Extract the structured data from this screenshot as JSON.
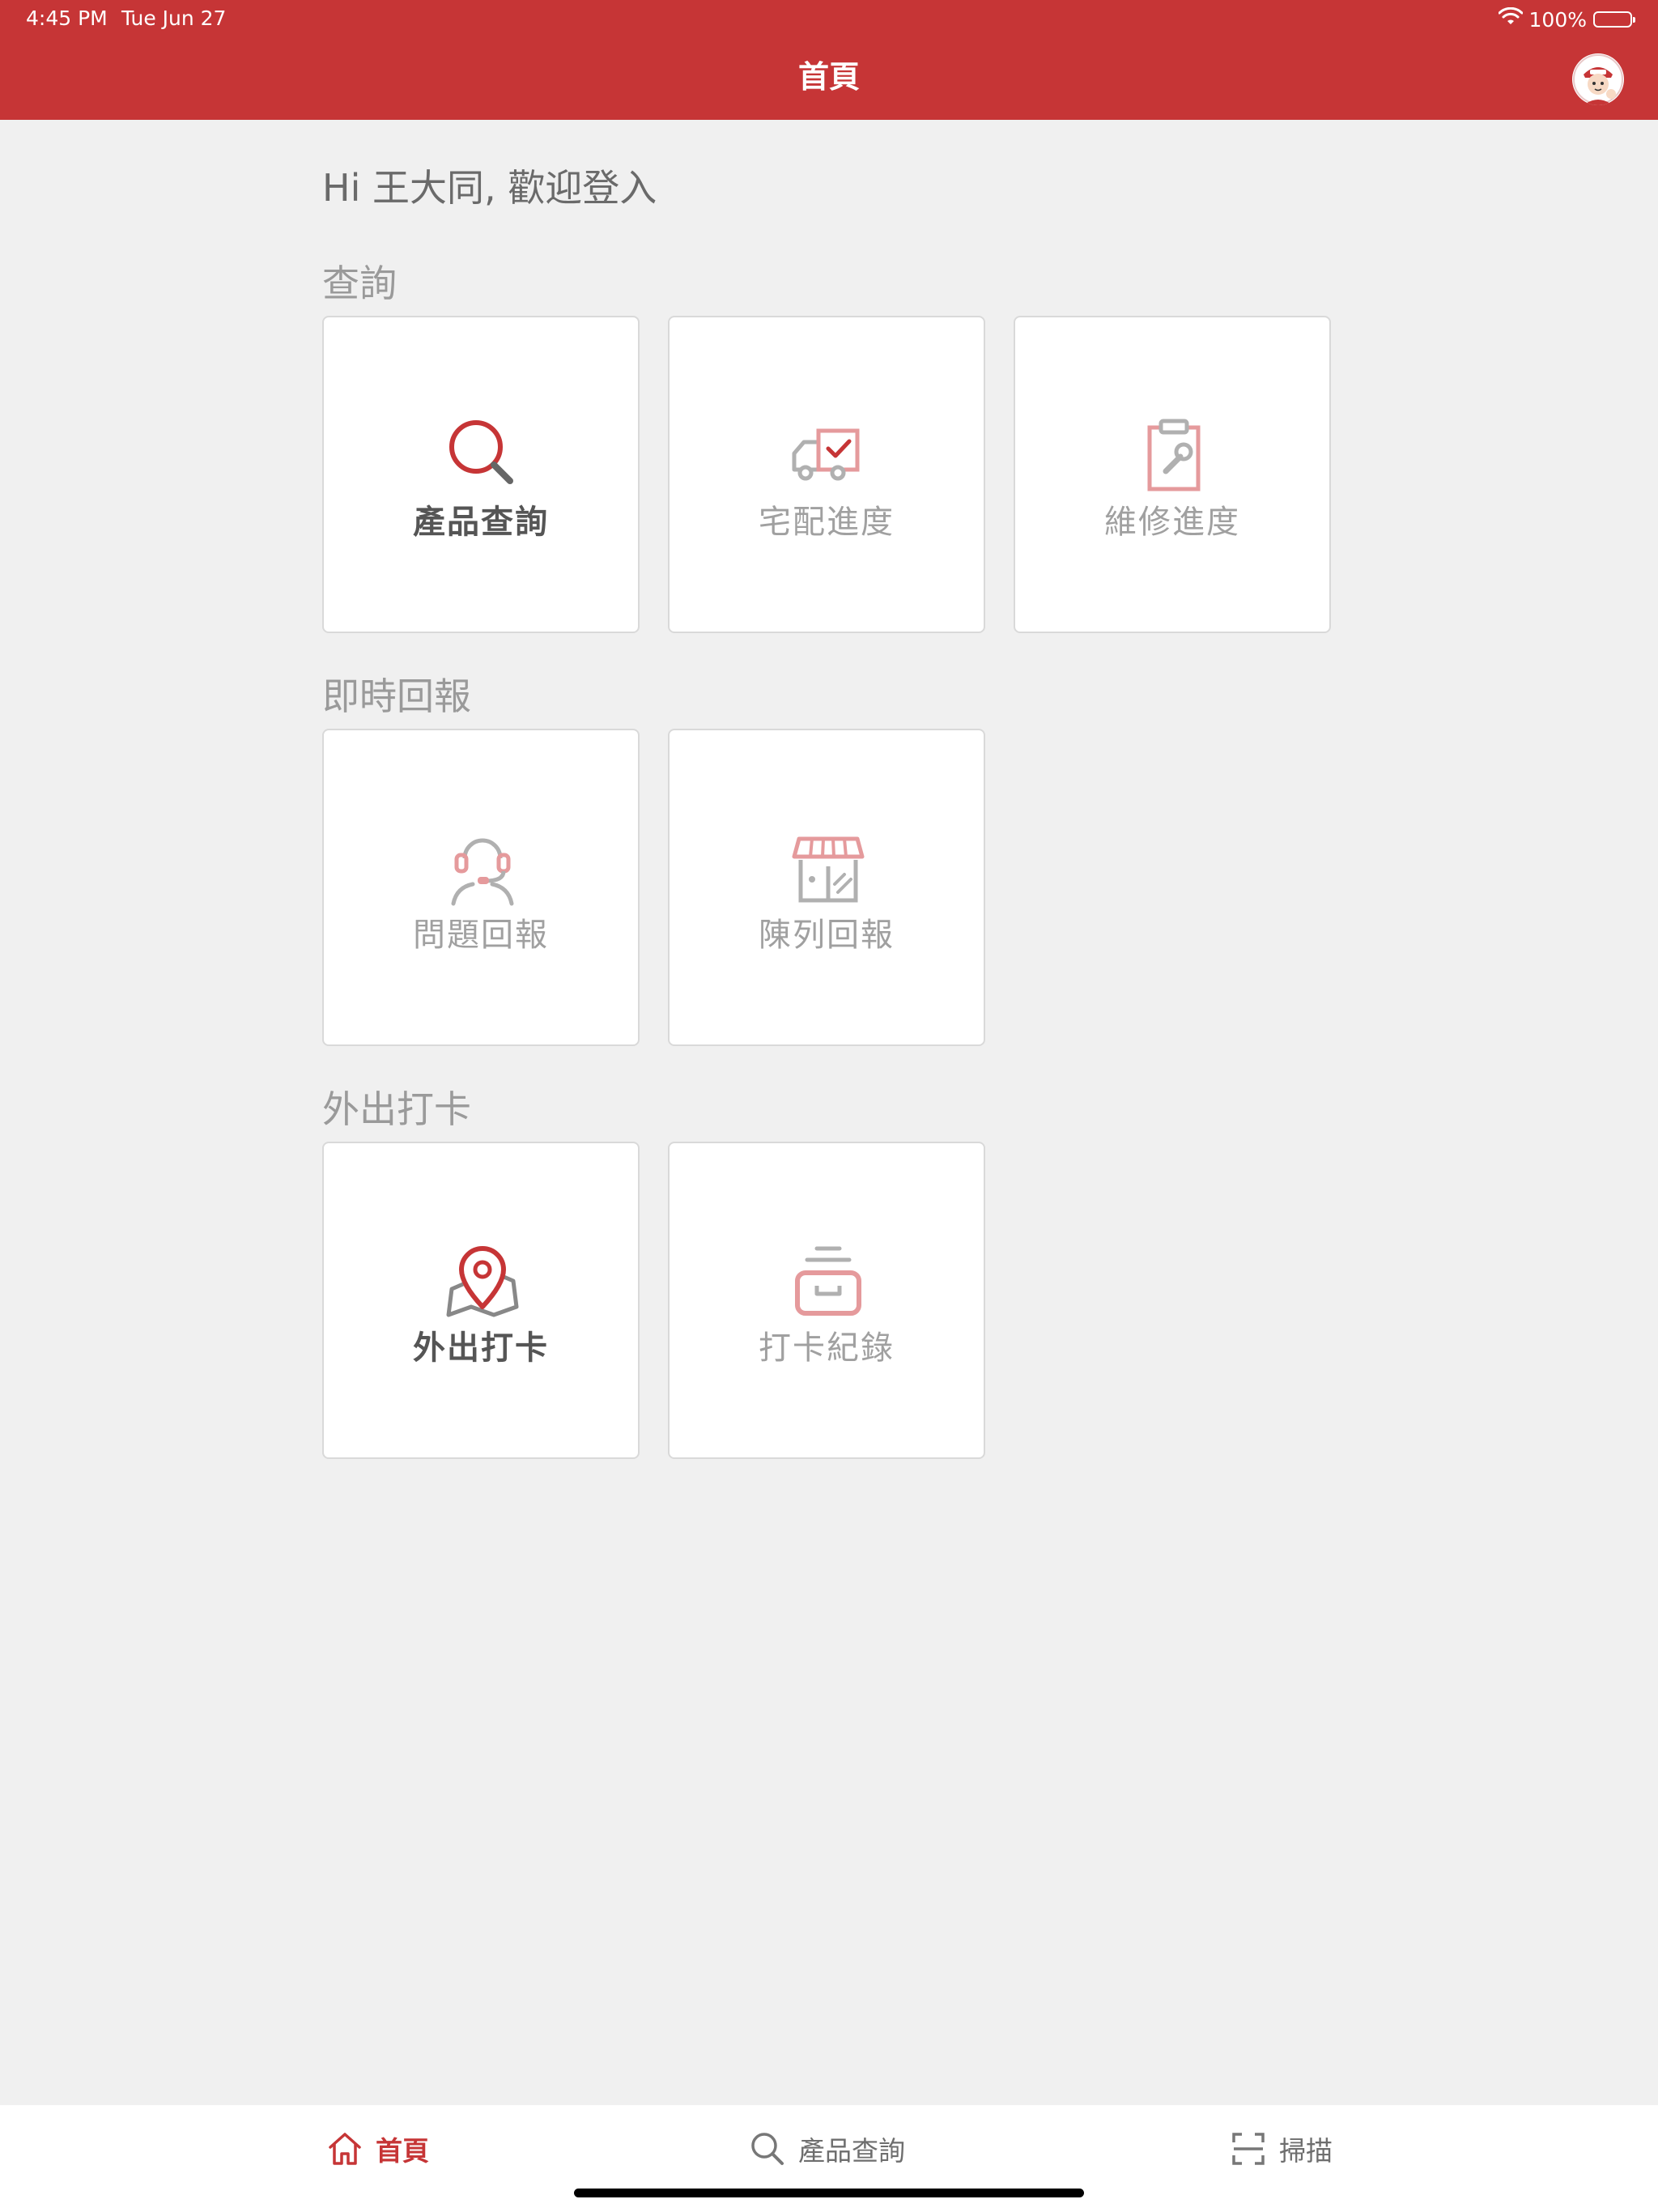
{
  "status_bar": {
    "time": "4:45 PM",
    "date": "Tue Jun 27",
    "battery": "100%"
  },
  "header": {
    "title": "首頁"
  },
  "greeting": "Hi 王大同, 歡迎登入",
  "sections": {
    "query": {
      "title": "查詢",
      "cards": [
        {
          "label": "產品查詢",
          "icon": "search-icon",
          "active": true
        },
        {
          "label": "宅配進度",
          "icon": "delivery-truck-icon",
          "active": false
        },
        {
          "label": "維修進度",
          "icon": "repair-clipboard-icon",
          "active": false
        }
      ]
    },
    "report": {
      "title": "即時回報",
      "cards": [
        {
          "label": "問題回報",
          "icon": "headset-agent-icon",
          "active": false
        },
        {
          "label": "陳列回報",
          "icon": "storefront-icon",
          "active": false
        }
      ]
    },
    "checkin": {
      "title": "外出打卡",
      "cards": [
        {
          "label": "外出打卡",
          "icon": "map-pin-icon",
          "active": true
        },
        {
          "label": "打卡紀錄",
          "icon": "archive-box-icon",
          "active": false
        }
      ]
    }
  },
  "tabbar": {
    "home": {
      "label": "首頁",
      "icon": "home-icon",
      "active": true
    },
    "product": {
      "label": "產品查詢",
      "icon": "search-icon"
    },
    "scan": {
      "label": "掃描",
      "icon": "scan-frame-icon"
    }
  },
  "colors": {
    "brand_red": "#c63536",
    "icon_pink": "#e59a9c",
    "icon_gray": "#b0b0b0",
    "background": "#f0f0f0"
  }
}
